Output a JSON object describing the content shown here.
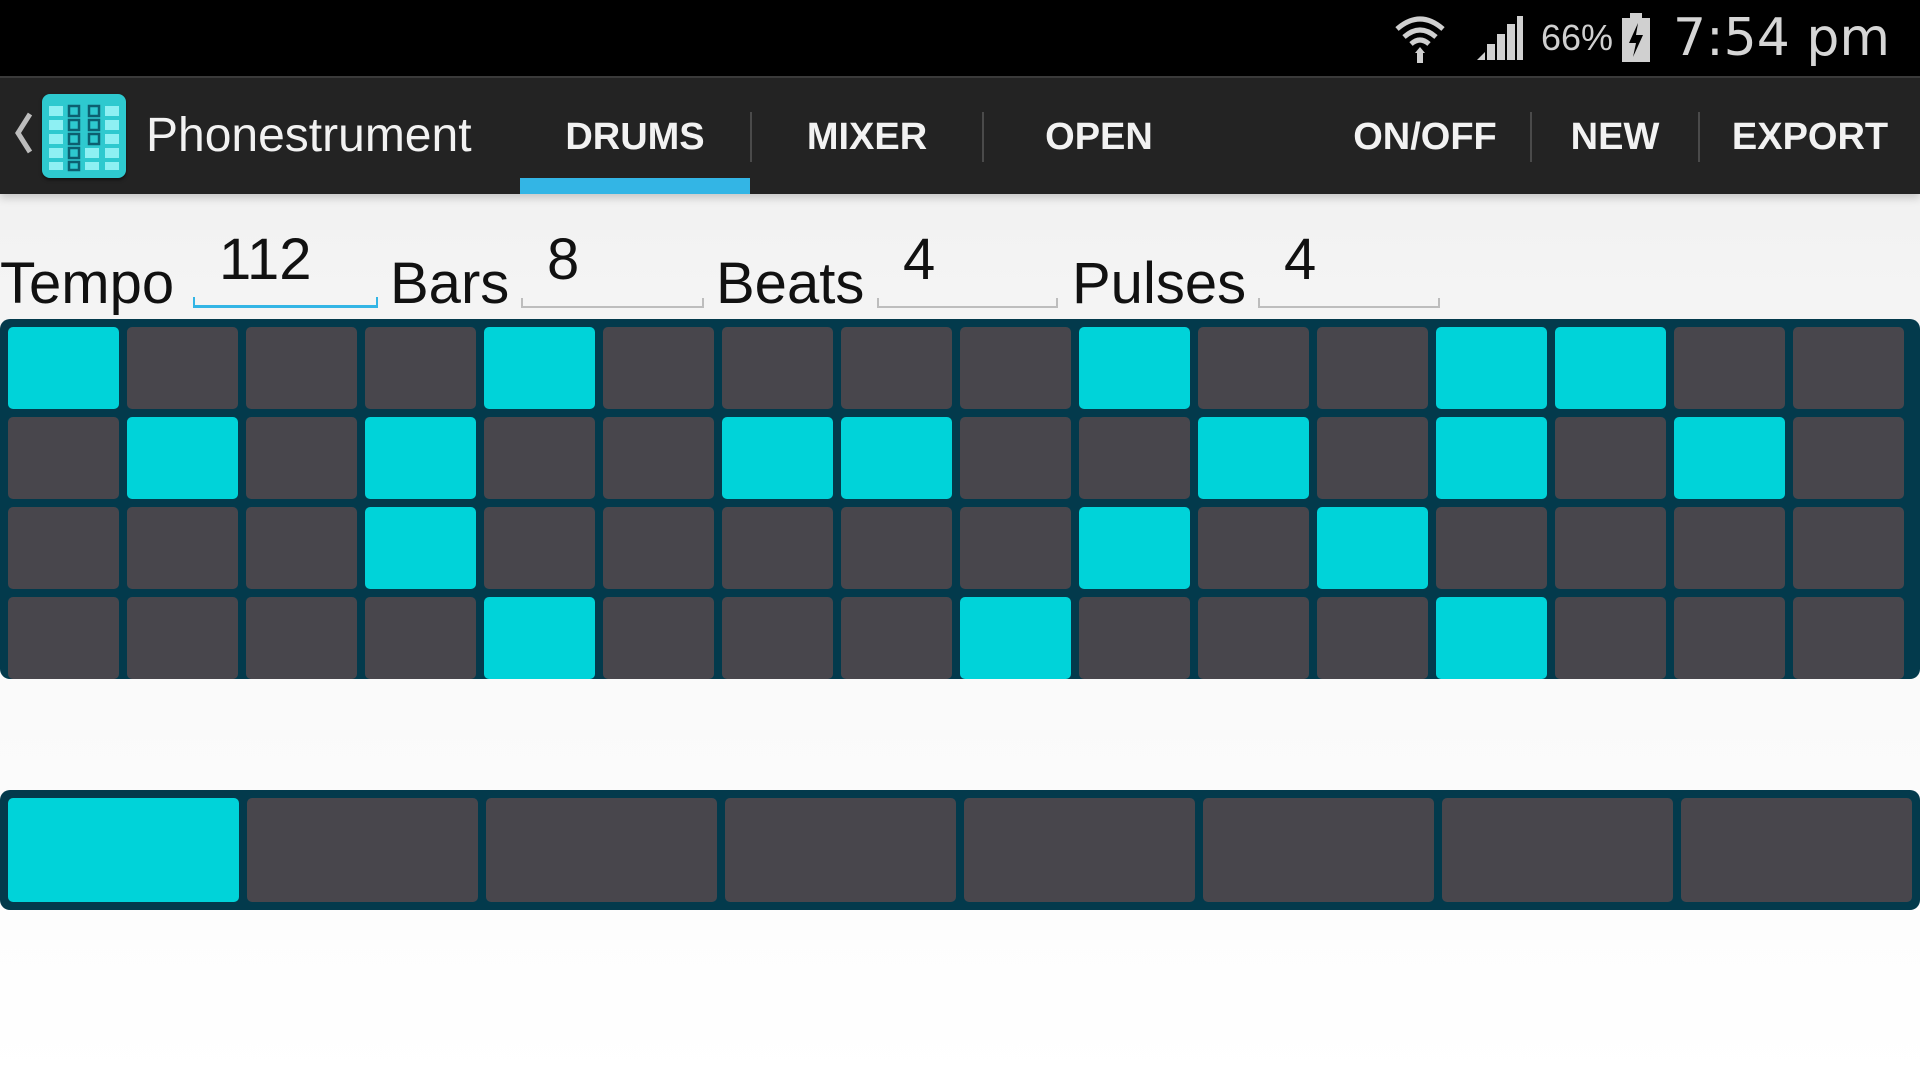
{
  "status_bar": {
    "battery_percent": "66%",
    "time": "7:54 pm",
    "icons": [
      "wifi-icon",
      "signal-icon",
      "battery-charging-icon"
    ]
  },
  "action_bar": {
    "app_title": "Phonestrument",
    "tabs": [
      {
        "label": "DRUMS",
        "selected": true
      },
      {
        "label": "MIXER",
        "selected": false
      },
      {
        "label": "OPEN",
        "selected": false
      }
    ],
    "actions": [
      {
        "label": "ON/OFF"
      },
      {
        "label": "NEW"
      },
      {
        "label": "EXPORT"
      }
    ],
    "accent_color": "#33b5e5"
  },
  "params": {
    "tempo": {
      "label": "Tempo",
      "value": "112"
    },
    "bars": {
      "label": "Bars",
      "value": "8"
    },
    "beats": {
      "label": "Beats",
      "value": "4"
    },
    "pulses": {
      "label": "Pulses",
      "value": "4"
    }
  },
  "colors": {
    "cell_on": "#00d3d9",
    "cell_off": "#48464c",
    "grid_background": "#033a4c"
  },
  "drum_grid": {
    "rows": [
      [
        1,
        0,
        0,
        0,
        1,
        0,
        0,
        0,
        0,
        1,
        0,
        0,
        1,
        1,
        0,
        0
      ],
      [
        0,
        1,
        0,
        1,
        0,
        0,
        1,
        1,
        0,
        0,
        1,
        0,
        1,
        0,
        1,
        0
      ],
      [
        0,
        0,
        0,
        1,
        0,
        0,
        0,
        0,
        0,
        1,
        0,
        1,
        0,
        0,
        0,
        0
      ],
      [
        0,
        0,
        0,
        0,
        1,
        0,
        0,
        0,
        1,
        0,
        0,
        0,
        1,
        0,
        0,
        0
      ]
    ]
  },
  "bar_grid": {
    "cells": [
      1,
      0,
      0,
      0,
      0,
      0,
      0,
      0
    ]
  }
}
